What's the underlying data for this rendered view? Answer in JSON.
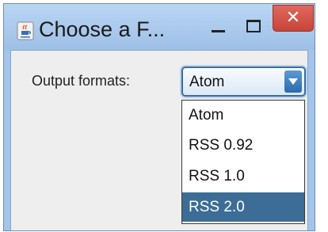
{
  "window": {
    "title": "Choose a F...",
    "icon": "java-cup-icon",
    "controls": {
      "minimize_icon": "minimize-icon",
      "maximize_icon": "maximize-icon",
      "close_glyph": "✕"
    }
  },
  "form": {
    "label": "Output formats:",
    "combo": {
      "selected": "Atom"
    },
    "options": [
      "Atom",
      "RSS 0.92",
      "RSS 1.0",
      "RSS 2.0"
    ],
    "highlighted_index": 3
  },
  "colors": {
    "titlebar": "#a3c5ec",
    "close_button": "#d4564a",
    "highlight": "#3c6d96",
    "dropdown_bg": "#ffffff"
  }
}
